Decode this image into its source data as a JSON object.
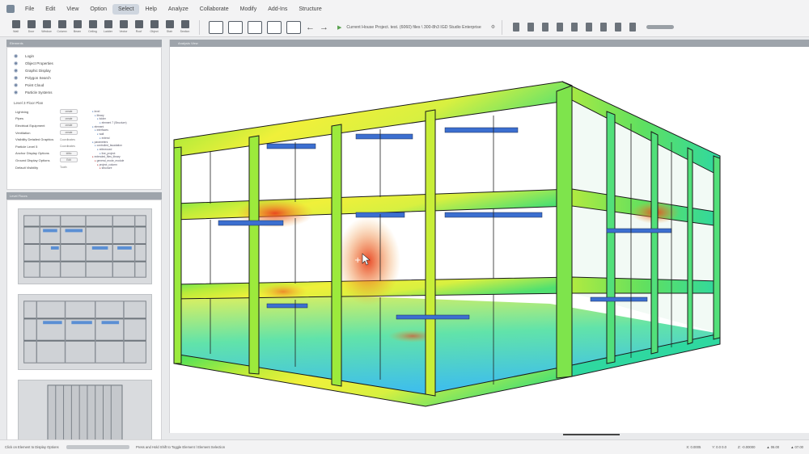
{
  "menu": [
    "File",
    "Edit",
    "View",
    "Option",
    "Select",
    "Help",
    "Analyze",
    "Collaborate",
    "Modify",
    "Add-Ins",
    "Structure"
  ],
  "menu_active": "Select",
  "toolbar": {
    "tools": [
      "Wall",
      "Door",
      "Window",
      "Column",
      "Beam",
      "Ceiling",
      "Ladder",
      "Vector",
      "Roof",
      "Object",
      "Stair",
      "Section"
    ],
    "project_path": "Current House Project. test. (6060) files \\ 300-8h3 IGD Studio Enterprise"
  },
  "left_panel": {
    "header": "Elements",
    "layers": [
      {
        "label": "Login",
        "icon": "login-icon"
      },
      {
        "label": "Object Properties",
        "icon": "object-properties-icon"
      },
      {
        "label": "Graphic Display",
        "icon": "graphic-display-icon"
      },
      {
        "label": "Polygon Search",
        "icon": "polygon-search-icon"
      },
      {
        "label": "Point Cloud",
        "icon": "point-cloud-icon"
      },
      {
        "label": "Particle Systems",
        "icon": "particle-systems-icon"
      }
    ],
    "section_title": "Level 3 Floor Plan",
    "options": [
      {
        "label": "Lightning",
        "control": "create"
      },
      {
        "label": "Pipes",
        "control": "create"
      },
      {
        "label": "Electrical Equipment",
        "control": "create"
      },
      {
        "label": "Ventilation",
        "control": "create"
      },
      {
        "label": "Visibility Detailed Graphics",
        "value": "Coordinates"
      },
      {
        "label": "Particle Level 5",
        "value": "Coordinates"
      },
      {
        "label": "Anchor Display Options",
        "control": "Iditio"
      },
      {
        "label": "Ground Display Options",
        "control": "Edit"
      },
      {
        "label": "Default Visibility",
        "value": "Tooth"
      }
    ],
    "tree": [
      "level",
      "library",
      "folder",
      "element 7 (Structure)",
      "element",
      "interfaces",
      "wall",
      "extend",
      "parameters",
      "controlled_facadation",
      "referenced",
      "line_project",
      "extended_files_library",
      "general_mode_module",
      "project_column",
      "structure"
    ],
    "thumbs_header": "Level Floors"
  },
  "viewport": {
    "header": "Analysis View"
  },
  "status": {
    "left": "Click on Element to Display Options",
    "hint": "Press and Hold Shift to Toggle Element / Element Selection",
    "right": [
      "X: 0.0005",
      "Y: 0.0 0.0",
      "Z: -0.00000",
      "▲ 06.00",
      "▲ 07.00"
    ]
  }
}
